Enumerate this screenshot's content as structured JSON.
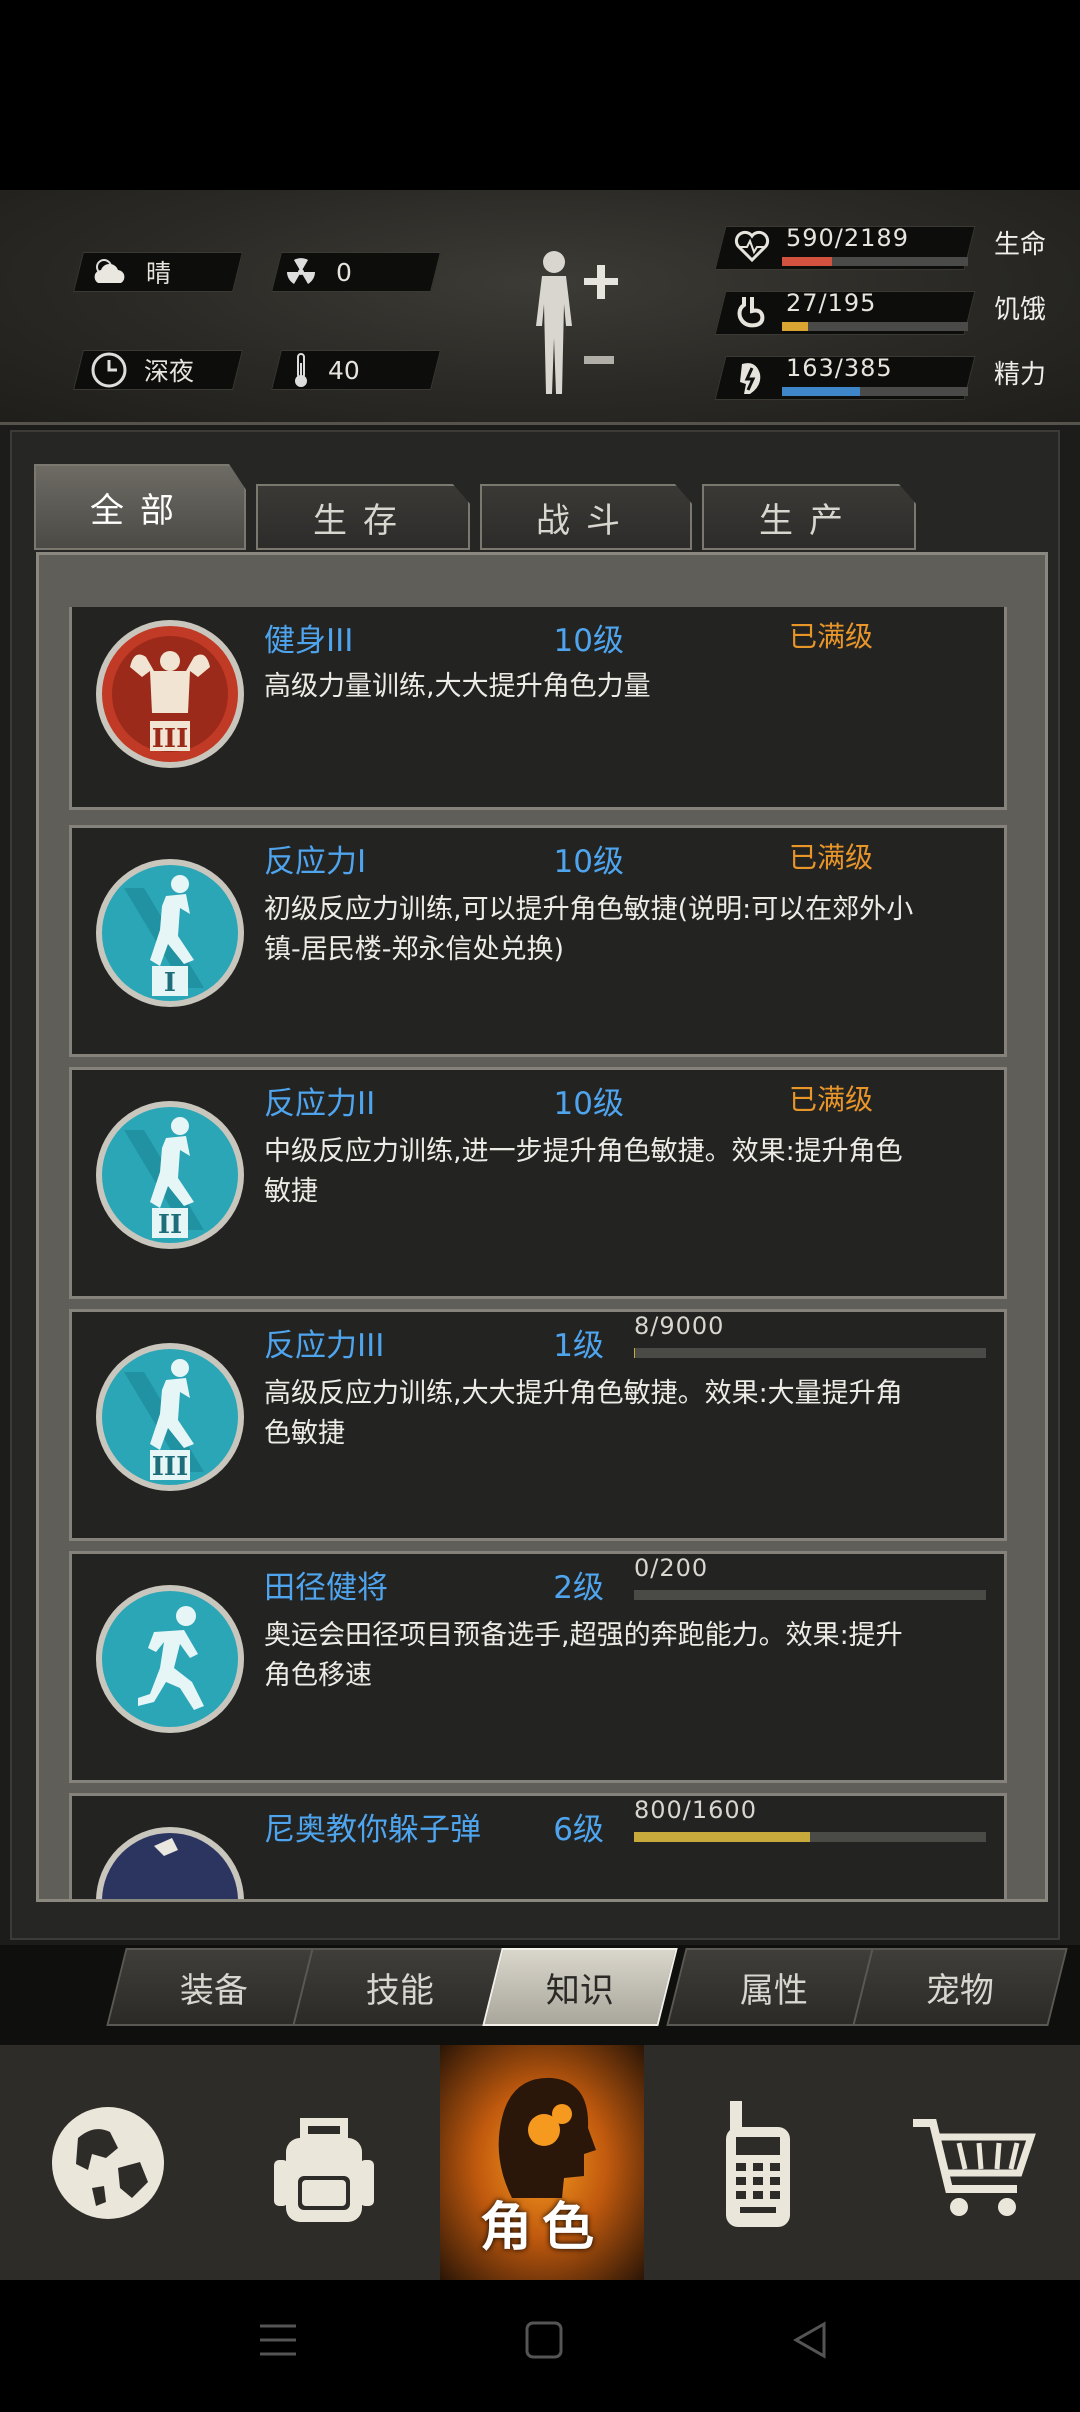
{
  "status": {
    "weather": "晴",
    "radiation": "0",
    "time_of_day": "深夜",
    "temperature": "40"
  },
  "vitals": [
    {
      "value": "590/2189",
      "label": "生命",
      "fraction": 0.27,
      "color": "#d2523f",
      "icon": "heart-icon"
    },
    {
      "value": "27/195",
      "label": "饥饿",
      "fraction": 0.14,
      "color": "#d9a431",
      "icon": "stomach-icon"
    },
    {
      "value": "163/385",
      "label": "精力",
      "fraction": 0.42,
      "color": "#3f86c9",
      "icon": "energy-icon"
    }
  ],
  "tabs": [
    "全部",
    "生存",
    "战斗",
    "生产"
  ],
  "skills": [
    {
      "name": "健身III",
      "level": "10级",
      "maxed": "已满级",
      "desc": "高级力量训练,大大提升角色力量",
      "icon": "bodybuilder-icon",
      "icon_color": "#c8412c"
    },
    {
      "name": "反应力I",
      "level": "10级",
      "maxed": "已满级",
      "desc": "初级反应力训练,可以提升角色敏捷(说明:可以在郊外小镇-居民楼-郑永信处兑换)",
      "icon": "agility-i-icon",
      "icon_color": "#2aa6b6"
    },
    {
      "name": "反应力II",
      "level": "10级",
      "maxed": "已满级",
      "desc": "中级反应力训练,进一步提升角色敏捷。效果:提升角色敏捷",
      "icon": "agility-ii-icon",
      "icon_color": "#2aa6b6"
    },
    {
      "name": "反应力III",
      "level": "1级",
      "xp": "8/9000",
      "xp_fraction": 0.001,
      "desc": "高级反应力训练,大大提升角色敏捷。效果:大量提升角色敏捷",
      "icon": "agility-iii-icon",
      "icon_color": "#2aa6b6"
    },
    {
      "name": "田径健将",
      "level": "2级",
      "xp": "0/200",
      "xp_fraction": 0.0,
      "desc": "奥运会田径项目预备选手,超强的奔跑能力。效果:提升角色移速",
      "icon": "runner-icon",
      "icon_color": "#2aa6b6"
    },
    {
      "name": "尼奥教你躲子弹",
      "level": "6级",
      "xp": "800/1600",
      "xp_fraction": 0.5,
      "desc": "",
      "icon": "matrix-dodge-icon",
      "icon_color": "#2c3560"
    }
  ],
  "subtabs": [
    "装备",
    "技能",
    "知识",
    "属性",
    "宠物"
  ],
  "active_subtab": "知识",
  "nav": {
    "active_label": "角色"
  }
}
